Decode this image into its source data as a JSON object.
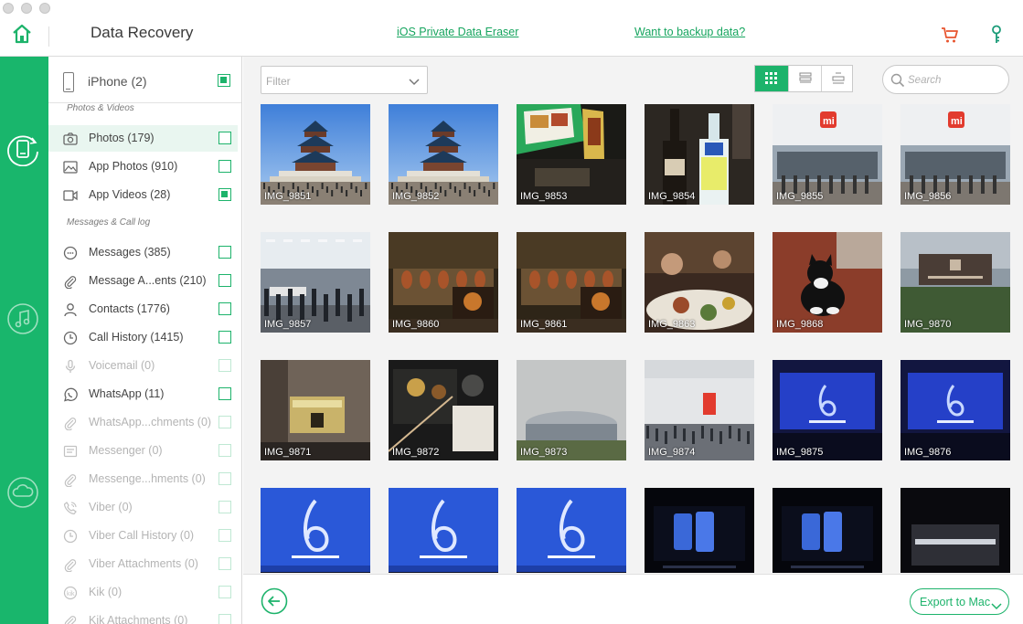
{
  "window": {
    "title": "Data Recovery"
  },
  "header": {
    "links": [
      "iOS Private Data Eraser",
      "Want to backup data?"
    ]
  },
  "rail": {
    "items": [
      "device-icon",
      "music-icon",
      "cloud-icon"
    ]
  },
  "device": {
    "label": "iPhone (2)",
    "checked": true
  },
  "sections": [
    {
      "title": "Photos & Videos",
      "items": [
        {
          "label": "Photos (179)",
          "icon": "camera-icon",
          "checked": false,
          "selected": true,
          "disabled": false
        },
        {
          "label": "App Photos (910)",
          "icon": "image-icon",
          "checked": false,
          "selected": false,
          "disabled": false
        },
        {
          "label": "App Videos (28)",
          "icon": "video-icon",
          "checked": true,
          "selected": false,
          "disabled": false
        }
      ]
    },
    {
      "title": "Messages & Call log",
      "items": [
        {
          "label": "Messages (385)",
          "icon": "message-icon",
          "checked": false,
          "selected": false,
          "disabled": false
        },
        {
          "label": "Message A...ents (210)",
          "icon": "paperclip-icon",
          "checked": false,
          "selected": false,
          "disabled": false
        },
        {
          "label": "Contacts (1776)",
          "icon": "contact-icon",
          "checked": false,
          "selected": false,
          "disabled": false
        },
        {
          "label": "Call History (1415)",
          "icon": "clock-icon",
          "checked": false,
          "selected": false,
          "disabled": false
        },
        {
          "label": "Voicemail (0)",
          "icon": "microphone-icon",
          "checked": false,
          "selected": false,
          "disabled": true
        },
        {
          "label": "WhatsApp (11)",
          "icon": "whatsapp-icon",
          "checked": false,
          "selected": false,
          "disabled": false
        },
        {
          "label": "WhatsApp...chments (0)",
          "icon": "paperclip-icon",
          "checked": false,
          "selected": false,
          "disabled": true
        },
        {
          "label": "Messenger (0)",
          "icon": "messenger-icon",
          "checked": false,
          "selected": false,
          "disabled": true
        },
        {
          "label": "Messenge...hments (0)",
          "icon": "paperclip-icon",
          "checked": false,
          "selected": false,
          "disabled": true
        },
        {
          "label": "Viber (0)",
          "icon": "viber-icon",
          "checked": false,
          "selected": false,
          "disabled": true
        },
        {
          "label": "Viber Call History (0)",
          "icon": "clock-icon",
          "checked": false,
          "selected": false,
          "disabled": true
        },
        {
          "label": "Viber Attachments (0)",
          "icon": "paperclip-icon",
          "checked": false,
          "selected": false,
          "disabled": true
        },
        {
          "label": "Kik (0)",
          "icon": "kik-icon",
          "checked": false,
          "selected": false,
          "disabled": true
        },
        {
          "label": "Kik Attachments (0)",
          "icon": "paperclip-icon",
          "checked": false,
          "selected": false,
          "disabled": true
        }
      ]
    }
  ],
  "toolbar": {
    "filter_placeholder": "Filter",
    "search_placeholder": "Search",
    "view_modes": [
      "grid-view-icon",
      "compact-view-icon",
      "list-view-icon"
    ],
    "active_view": 0
  },
  "photos": [
    {
      "name": "IMG_9851",
      "scene": "temple"
    },
    {
      "name": "IMG_9852",
      "scene": "temple"
    },
    {
      "name": "IMG_9853",
      "scene": "restaurant-menu"
    },
    {
      "name": "IMG_9854",
      "scene": "bottles"
    },
    {
      "name": "IMG_9855",
      "scene": "mi-store"
    },
    {
      "name": "IMG_9856",
      "scene": "mi-store"
    },
    {
      "name": "IMG_9857",
      "scene": "store-interior"
    },
    {
      "name": "IMG_9860",
      "scene": "kitchen"
    },
    {
      "name": "IMG_9861",
      "scene": "kitchen"
    },
    {
      "name": "IMG_9863",
      "scene": "dinner"
    },
    {
      "name": "IMG_9868",
      "scene": "cat"
    },
    {
      "name": "IMG_9870",
      "scene": "building-sign"
    },
    {
      "name": "IMG_9871",
      "scene": "street-sign"
    },
    {
      "name": "IMG_9872",
      "scene": "food-box"
    },
    {
      "name": "IMG_9873",
      "scene": "stadium"
    },
    {
      "name": "IMG_9874",
      "scene": "arena-entrance"
    },
    {
      "name": "IMG_9875",
      "scene": "stage-blue"
    },
    {
      "name": "IMG_9876",
      "scene": "stage-blue"
    },
    {
      "name": "",
      "scene": "stage-six"
    },
    {
      "name": "",
      "scene": "stage-six"
    },
    {
      "name": "",
      "scene": "stage-six"
    },
    {
      "name": "",
      "scene": "stage-phone"
    },
    {
      "name": "",
      "scene": "stage-phone"
    },
    {
      "name": "",
      "scene": "stage-dark"
    }
  ],
  "footer": {
    "export_label": "Export to Mac"
  },
  "colors": {
    "accent": "#1db36b",
    "rail": "#19b66c",
    "cart": "#e8542e",
    "link": "#17a55f"
  }
}
